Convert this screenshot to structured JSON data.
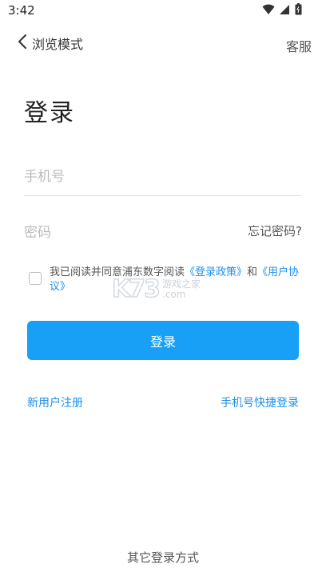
{
  "status_bar": {
    "time": "3:42",
    "icons": [
      "wifi-icon",
      "signal-icon",
      "battery-icon"
    ]
  },
  "nav": {
    "back_label": "浏览模式",
    "service_label": "客服"
  },
  "page": {
    "title": "登录"
  },
  "form": {
    "phone_placeholder": "手机号",
    "password_placeholder": "密码",
    "forgot_label": "忘记密码?"
  },
  "agreement": {
    "prefix": "我已阅读并同意浦东数字阅读",
    "policy_link": "《登录政策》",
    "and": "和",
    "user_link": "《用户协议》",
    "checked": false
  },
  "buttons": {
    "login": "登录",
    "register": "新用户注册",
    "quick_login": "手机号快捷登录",
    "other_login": "其它登录方式"
  },
  "watermark": {
    "logo": "K73",
    "line1": "游戏之家",
    "line2": ".com"
  },
  "colors": {
    "accent": "#17a0f5",
    "link": "#1e8fe8"
  }
}
